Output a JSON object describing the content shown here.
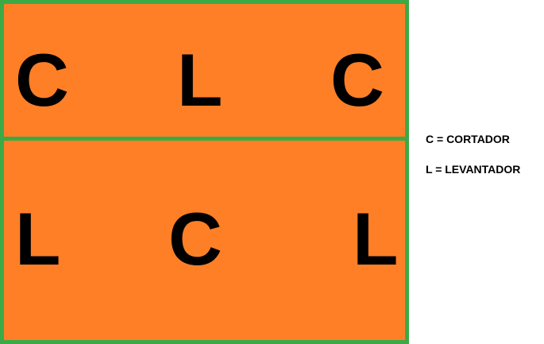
{
  "colors": {
    "panel_fill": "#ff7f27",
    "panel_border": "#3aaa47",
    "text": "#000000",
    "background": "#ffffff"
  },
  "panels": [
    {
      "letters": [
        "C",
        "L",
        "C"
      ]
    },
    {
      "letters": [
        "L",
        "C",
        "L"
      ]
    }
  ],
  "legend": [
    "C = CORTADOR",
    "L = LEVANTADOR"
  ]
}
